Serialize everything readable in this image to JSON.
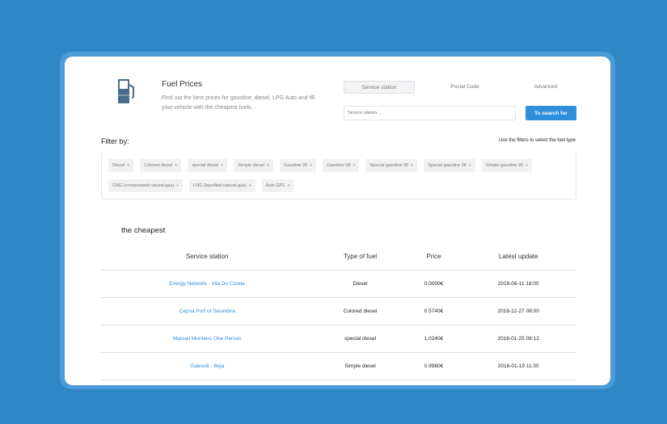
{
  "header": {
    "title": "Fuel Prices",
    "description": "Find out the best prices for gasoline, diesel, LPG Auto and fill your vehicle with the cheapest fuels.",
    "icon": "fuel-pump-icon"
  },
  "search": {
    "tabs": [
      "Service station",
      "Postal Code",
      "Advanced"
    ],
    "active_tab": "Service station",
    "placeholder": "Service station ...",
    "button": "To search for"
  },
  "filter": {
    "label": "Filter by:",
    "hint": "Use the filters to select the fuel type",
    "remove_glyph": "+",
    "chips": [
      "Diesel",
      "Colored diesel",
      "special diesel",
      "Simple diesel",
      "Gasoline 95",
      "Gasoline 98",
      "Special gasoline 95",
      "Special gasoline 98",
      "Simple gasoline 95",
      "CNG (compressed natural gas)",
      "LNG (liquefied natural gas)",
      "Auto GPL"
    ]
  },
  "results": {
    "title": "the cheapest",
    "columns": [
      "Service station",
      "Type of fuel",
      "Price",
      "Latest update"
    ],
    "rows": [
      {
        "station": "Energy Network - Vila Do Conde",
        "fuel": "Diesel",
        "price": "0.0000€",
        "updated": "2019-06-11 18:00"
      },
      {
        "station": "Cepsa Port of Sesimbra",
        "fuel": "Colored diesel",
        "price": "0.5740€",
        "updated": "2016-12-27 08:00"
      },
      {
        "station": "Manuel Monteiro One Person",
        "fuel": "special diesel",
        "price": "1,0240€",
        "updated": "2016-01-25 08:12"
      },
      {
        "station": "Galexoil - Beja",
        "fuel": "Simple diesel",
        "price": "0.9980€",
        "updated": "2016-01-19 11:00"
      }
    ]
  },
  "colors": {
    "background": "#2f87c6",
    "accent": "#2f8fdc"
  }
}
